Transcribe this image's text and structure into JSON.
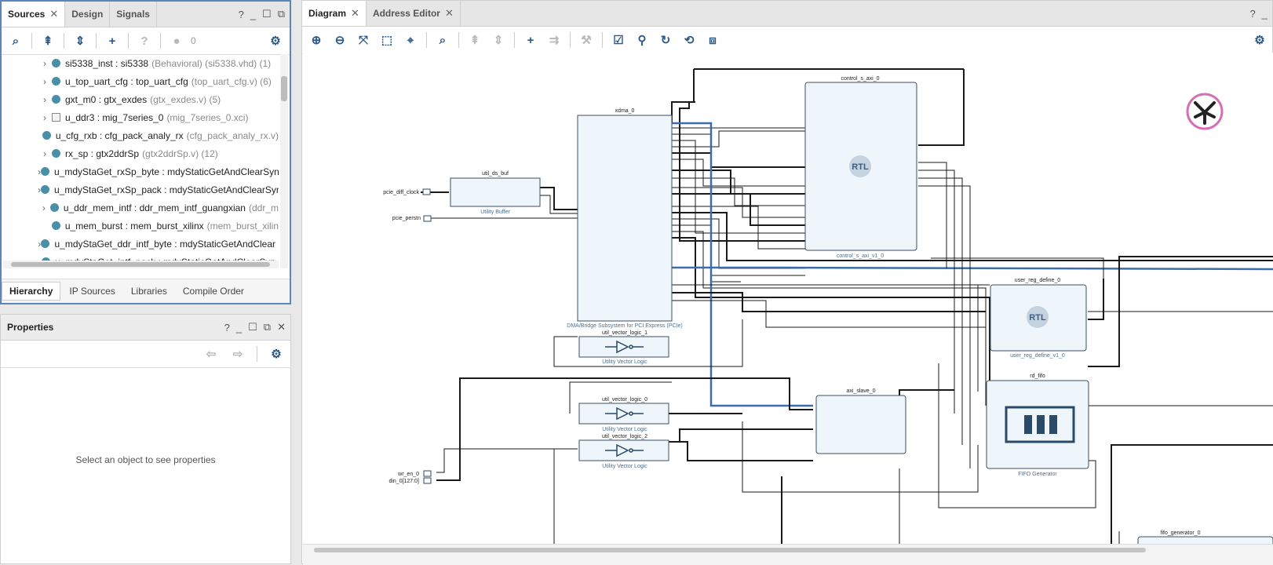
{
  "sources": {
    "tabs": [
      "Sources",
      "Design",
      "Signals"
    ],
    "win_controls": [
      "?",
      "_",
      "☐",
      "⧉"
    ],
    "badge_count": "0",
    "tree": [
      {
        "name": "si5338_inst",
        "module": "si5338",
        "extra": "(Behavioral) (si5338.vhd) (1)",
        "icon": "dot",
        "expand": true
      },
      {
        "name": "u_top_uart_cfg",
        "module": "top_uart_cfg",
        "extra": "(top_uart_cfg.v) (6)",
        "icon": "dot",
        "expand": true
      },
      {
        "name": "gxt_m0",
        "module": "gtx_exdes",
        "extra": "(gtx_exdes.v) (5)",
        "icon": "dot",
        "expand": true
      },
      {
        "name": "u_ddr3",
        "module": "mig_7series_0",
        "extra": "(mig_7series_0.xci)",
        "icon": "chip",
        "expand": true
      },
      {
        "name": "u_cfg_rxb",
        "module": "cfg_pack_analy_rx",
        "extra": "(cfg_pack_analy_rx.v)",
        "icon": "dot",
        "expand": false
      },
      {
        "name": "rx_sp",
        "module": "gtx2ddrSp",
        "extra": "(gtx2ddrSp.v) (12)",
        "icon": "dot",
        "expand": true
      },
      {
        "name": "u_mdyStaGet_rxSp_byte",
        "module": "mdyStaticGetAndClearSyn",
        "extra": "",
        "icon": "dot",
        "expand": true
      },
      {
        "name": "u_mdyStaGet_rxSp_pack",
        "module": "mdyStaticGetAndClearSyn",
        "extra": "",
        "icon": "dot",
        "expand": true
      },
      {
        "name": "u_ddr_mem_intf",
        "module": "ddr_mem_intf_guangxian",
        "extra": "(ddr_m",
        "icon": "dot",
        "expand": true
      },
      {
        "name": "u_mem_burst",
        "module": "mem_burst_xilinx",
        "extra": "(mem_burst_xilin",
        "icon": "dot",
        "expand": false
      },
      {
        "name": "u_mdyStaGet_ddr_intf_byte",
        "module": "mdyStaticGetAndClear",
        "extra": "",
        "icon": "dot",
        "expand": true
      },
      {
        "name": "u_mdyStaGet_intf_pack",
        "module": "mdyStaticGetAndClearSyn",
        "extra": "",
        "icon": "dot",
        "expand": true
      }
    ],
    "bottom_tabs": [
      "Hierarchy",
      "IP Sources",
      "Libraries",
      "Compile Order"
    ]
  },
  "properties": {
    "title": "Properties",
    "placeholder": "Select an object to see properties"
  },
  "diagram_panel": {
    "tabs": [
      "Diagram",
      "Address Editor"
    ],
    "help": "?",
    "blocks": {
      "xdma": {
        "name": "xdma_0",
        "sub": "DMA/Bridge Subsystem for PCI Express (PCIe)"
      },
      "ds_buf": {
        "name": "util_ds_buf",
        "sub": "Utility Buffer"
      },
      "vec1": {
        "name": "util_vector_logic_1",
        "sub": "Utility Vector Logic"
      },
      "vec0": {
        "name": "util_vector_logic_0",
        "sub": "Utility Vector Logic"
      },
      "vec2": {
        "name": "util_vector_logic_2",
        "sub": "Utility Vector Logic"
      },
      "ctrl": {
        "name": "control_s_axi_0",
        "sub": "control_s_axi_v1_0",
        "badge": "RTL"
      },
      "user_reg": {
        "name": "user_reg_define_0",
        "sub": "user_reg_define_v1_0",
        "badge": "RTL"
      },
      "axi_slave": {
        "name": "axi_slave_0"
      },
      "rd_fifo": {
        "name": "rd_fifo",
        "sub": "FIFO Generator"
      },
      "fifo_gen": {
        "name": "fifo_generator_0"
      }
    },
    "ports": [
      "pcie_diff_clock",
      "pcie_perstn",
      "wr_en_0",
      "din_0[127:0]"
    ]
  },
  "colors": {
    "accent": "#2b5a8a",
    "block_fill": "#eef5fb",
    "bus": "#3d6da8"
  }
}
